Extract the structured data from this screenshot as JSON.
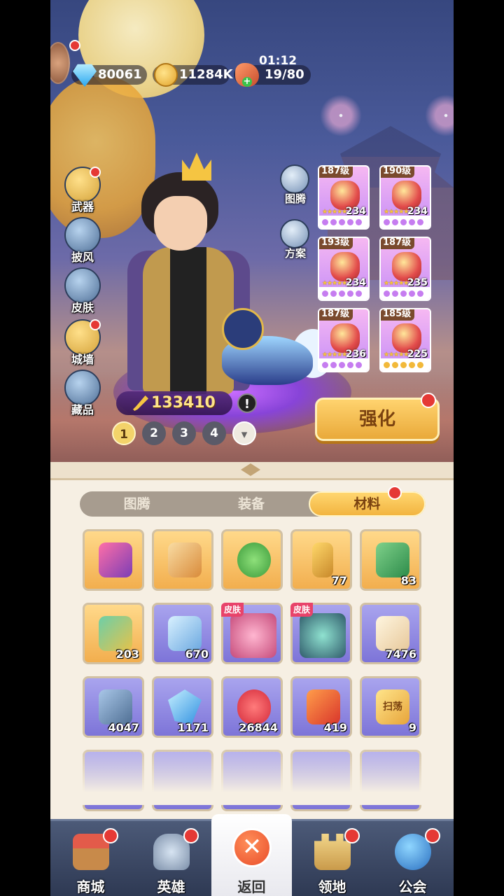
{
  "resources": {
    "diamonds": "80061",
    "gold": "11284K",
    "stamina": "19/80",
    "timer": "01:12"
  },
  "left_menu": [
    {
      "label": "武器",
      "icon": "weapon-icon",
      "badge": true
    },
    {
      "label": "披风",
      "icon": "cape-icon",
      "badge": false
    },
    {
      "label": "皮肤",
      "icon": "armor-icon",
      "badge": false
    },
    {
      "label": "城墙",
      "icon": "castle-wall-icon",
      "badge": true
    },
    {
      "label": "藏品",
      "icon": "collection-icon",
      "badge": false
    }
  ],
  "right_menu": [
    {
      "label": "图腾",
      "icon": "totem-icon"
    },
    {
      "label": "方案",
      "icon": "loadout-icon"
    }
  ],
  "equipment": [
    {
      "level": "187级",
      "value": "234",
      "gems": "purple"
    },
    {
      "level": "190级",
      "value": "234",
      "gems": "purple"
    },
    {
      "level": "193级",
      "value": "234",
      "gems": "purple"
    },
    {
      "level": "187级",
      "value": "235",
      "gems": "purple"
    },
    {
      "level": "187级",
      "value": "236",
      "gems": "purple"
    },
    {
      "level": "185级",
      "value": "225",
      "gems": "yellow"
    }
  ],
  "power": "133410",
  "pages": [
    "1",
    "2",
    "3",
    "4"
  ],
  "enhance_button": "强化",
  "tabs": [
    "图腾",
    "装备",
    "材料"
  ],
  "active_tab": 2,
  "materials": [
    {
      "icon": "music-card-icon",
      "count": "",
      "bg": "gold"
    },
    {
      "icon": "scroll-icon",
      "count": "",
      "bg": "gold"
    },
    {
      "icon": "clover-icon",
      "count": "",
      "bg": "gold"
    },
    {
      "icon": "key-icon",
      "count": "77",
      "bg": "gold"
    },
    {
      "icon": "soccer-ticket-icon",
      "count": "83",
      "bg": "gold"
    },
    {
      "icon": "cards-icon",
      "count": "203",
      "bg": "gold"
    },
    {
      "icon": "wrench-icon",
      "count": "670",
      "bg": "purp"
    },
    {
      "icon": "skin-girl-icon",
      "count": "",
      "bg": "purp",
      "tag": "皮肤"
    },
    {
      "icon": "skin-monster-icon",
      "count": "",
      "bg": "purp",
      "tag": "皮肤"
    },
    {
      "icon": "integral-card-icon",
      "count": "7476",
      "bg": "purp"
    },
    {
      "icon": "hammer-icon",
      "count": "4047",
      "bg": "purp"
    },
    {
      "icon": "crystal-icon",
      "count": "1171",
      "bg": "purp"
    },
    {
      "icon": "heart-icon",
      "count": "26844",
      "bg": "purp"
    },
    {
      "icon": "fire-ticket-icon",
      "count": "419",
      "bg": "purp"
    },
    {
      "icon": "sweep-ticket-icon",
      "count": "9",
      "bg": "purp",
      "text": "扫荡"
    }
  ],
  "nav": [
    {
      "label": "商城",
      "icon": "shop-icon",
      "badge": true
    },
    {
      "label": "英雄",
      "icon": "helmet-icon",
      "badge": true
    },
    {
      "label": "返回",
      "icon": "close-icon",
      "badge": false
    },
    {
      "label": "领地",
      "icon": "castle-icon",
      "badge": true
    },
    {
      "label": "公会",
      "icon": "planet-icon",
      "badge": true
    }
  ]
}
